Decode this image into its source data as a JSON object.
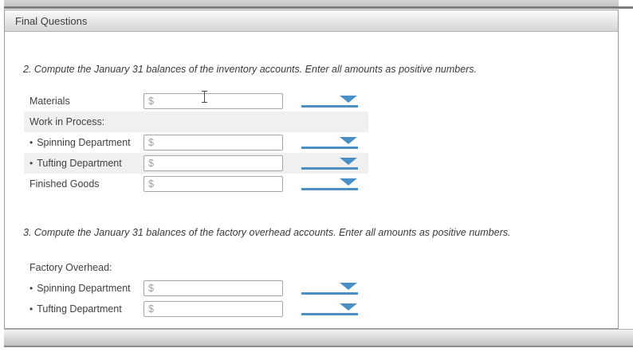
{
  "panel": {
    "title": "Final Questions"
  },
  "accent_color": "#4c8fc4",
  "shaded_row_color": "#f0f0f0",
  "glyphs": {
    "bullet": "•"
  },
  "questions": [
    {
      "number": "2",
      "prompt": "2. Compute the January 31 balances of the inventory accounts. Enter all amounts as positive numbers.",
      "rows": [
        {
          "type": "field",
          "label": "Materials",
          "prefix": "$",
          "value": "",
          "shaded": false,
          "bullet": false
        },
        {
          "type": "header",
          "label": "Work in Process:",
          "shaded": true
        },
        {
          "type": "field",
          "label": "Spinning Department",
          "prefix": "$",
          "value": "",
          "shaded": false,
          "bullet": true
        },
        {
          "type": "field",
          "label": "Tufting Department",
          "prefix": "$",
          "value": "",
          "shaded": true,
          "bullet": true
        },
        {
          "type": "field",
          "label": "Finished Goods",
          "prefix": "$",
          "value": "",
          "shaded": false,
          "bullet": false
        }
      ]
    },
    {
      "number": "3",
      "prompt": "3. Compute the January 31 balances of the factory overhead accounts. Enter all amounts as positive numbers.",
      "rows": [
        {
          "type": "header",
          "label": "Factory Overhead:",
          "shaded": false
        },
        {
          "type": "field",
          "label": "Spinning Department",
          "prefix": "$",
          "value": "",
          "shaded": false,
          "bullet": true
        },
        {
          "type": "field",
          "label": "Tufting Department",
          "prefix": "$",
          "value": "",
          "shaded": false,
          "bullet": true
        }
      ]
    }
  ]
}
